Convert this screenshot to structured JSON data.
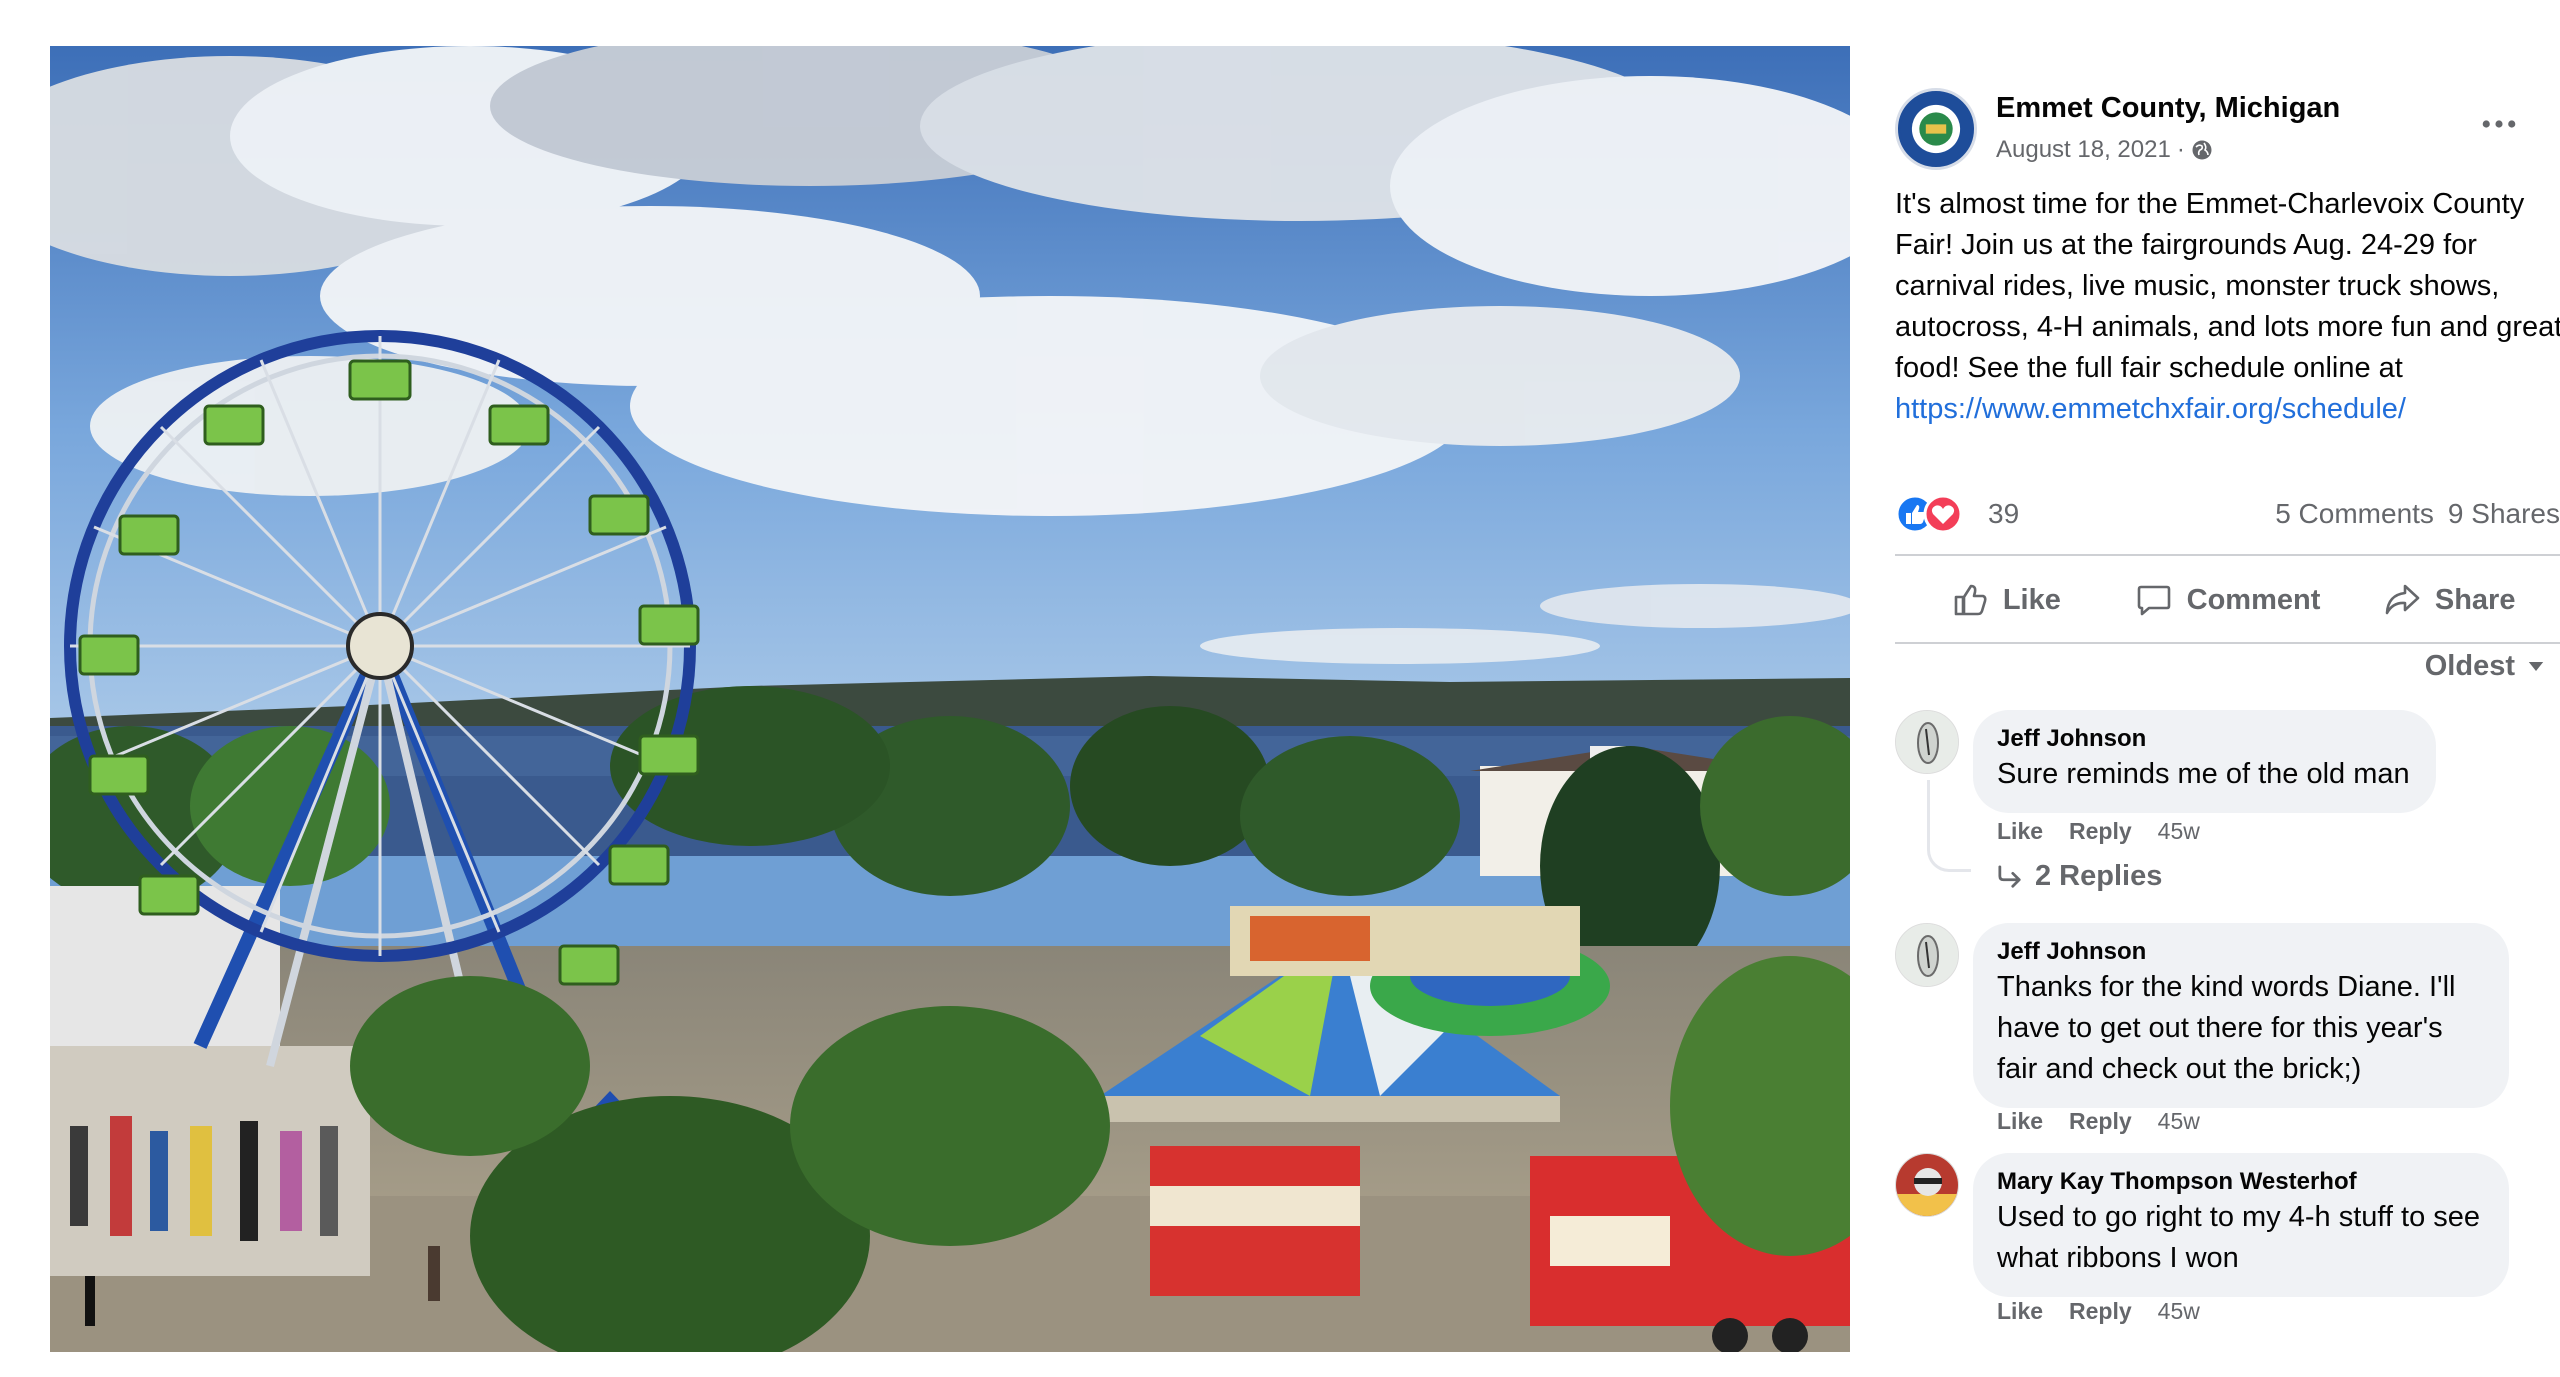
{
  "photo": {
    "alt": ""
  },
  "post": {
    "page_name": "Emmet County, Michigan",
    "date": "August 18, 2021",
    "meta_separator": "·",
    "avatar_icon": "county-seal-icon",
    "privacy_icon": "globe-icon",
    "more_icon": "more-dots-icon",
    "text": "It's almost time for the Emmet-Charlevoix County Fair! Join us at the fairgrounds Aug. 24-29 for carnival rides, live music, monster truck shows, autocross, 4-H animals, and lots more fun and great food! See the full fair schedule online at",
    "link": "https://www.emmetchxfair.org/schedule/"
  },
  "reactions": {
    "icons": [
      "like-reaction-icon",
      "love-reaction-icon"
    ],
    "count": "39",
    "comments": "5 Comments",
    "shares": "9 Shares"
  },
  "actions": {
    "like": "Like",
    "comment": "Comment",
    "share": "Share"
  },
  "sort": {
    "label": "Oldest"
  },
  "comments": [
    {
      "author": "Jeff Johnson",
      "text": "Sure reminds me of the old man",
      "like": "Like",
      "reply": "Reply",
      "time": "45w",
      "replies": "2 Replies"
    },
    {
      "author": "Jeff Johnson",
      "text": "Thanks for the kind words Diane. I'll have to get out there for this year's fair and check out the brick;)",
      "like": "Like",
      "reply": "Reply",
      "time": "45w"
    },
    {
      "author": "Mary Kay Thompson Westerhof",
      "text": "Used to go right to my 4-h stuff to see what ribbons I won",
      "like": "Like",
      "reply": "Reply",
      "time": "45w"
    }
  ],
  "colors": {
    "link": "#216fdb",
    "secondary_text": "#65676b",
    "bubble": "#f0f2f5",
    "like_blue": "#1877f2",
    "love_red": "#f33e58"
  }
}
